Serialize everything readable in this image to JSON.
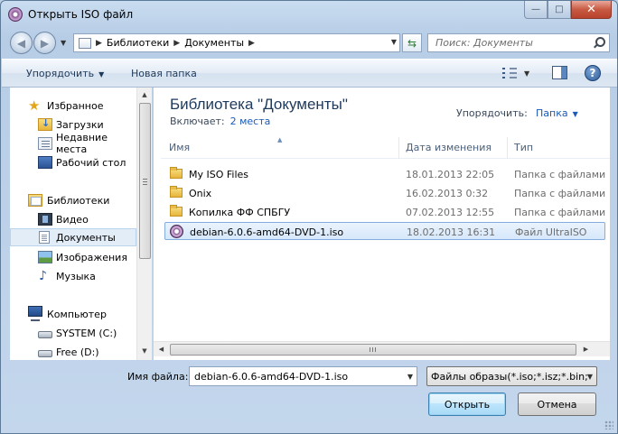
{
  "window": {
    "title": "Открыть ISO файл",
    "controls": {
      "minimize": "—",
      "maximize": "□",
      "close": "✕"
    }
  },
  "address": {
    "crumbs": [
      "Библиотеки",
      "Документы"
    ],
    "search_placeholder": "Поиск: Документы"
  },
  "toolbar": {
    "organize": "Упорядочить",
    "new_folder": "Новая папка",
    "help": "?"
  },
  "nav": {
    "favorites": {
      "label": "Избранное",
      "icon": "star-icon"
    },
    "downloads": {
      "label": "Загрузки",
      "icon": "downloads-folder-icon"
    },
    "recent": {
      "label": "Недавние места",
      "icon": "recent-places-icon"
    },
    "desktop": {
      "label": "Рабочий стол",
      "icon": "desktop-icon"
    },
    "libraries": {
      "label": "Библиотеки",
      "icon": "libraries-icon"
    },
    "video": {
      "label": "Видео",
      "icon": "video-icon"
    },
    "documents": {
      "label": "Документы",
      "icon": "documents-icon"
    },
    "images": {
      "label": "Изображения",
      "icon": "images-icon"
    },
    "music": {
      "label": "Музыка",
      "icon": "music-icon"
    },
    "computer": {
      "label": "Компьютер",
      "icon": "computer-icon"
    },
    "drive_c": {
      "label": "SYSTEM (C:)",
      "icon": "drive-icon"
    },
    "drive_d": {
      "label": "Free (D:)",
      "icon": "drive-icon"
    }
  },
  "library": {
    "title": "Библиотека \"Документы\"",
    "includes_label": "Включает:",
    "includes_link": "2 места",
    "arrange_label": "Упорядочить:",
    "arrange_value": "Папка"
  },
  "columns": {
    "name": "Имя",
    "date": "Дата изменения",
    "type": "Тип"
  },
  "files": [
    {
      "name": "My ISO Files",
      "date": "18.01.2013 22:05",
      "type": "Папка с файлами",
      "icon": "folder-icon"
    },
    {
      "name": "Onix",
      "date": "16.02.2013 0:32",
      "type": "Папка с файлами",
      "icon": "folder-icon"
    },
    {
      "name": "Копилка ФФ СПБГУ",
      "date": "07.02.2013 12:55",
      "type": "Папка с файлами",
      "icon": "folder-icon"
    },
    {
      "name": "debian-6.0.6-amd64-DVD-1.iso",
      "date": "18.02.2013 16:31",
      "type": "Файл UltraISO",
      "icon": "iso-file-icon",
      "selected": true
    }
  ],
  "bottom": {
    "filename_label": "Имя файла:",
    "filename_value": "debian-6.0.6-amd64-DVD-1.iso",
    "filter_value": "Файлы образы(*.iso;*.isz;*.bin;",
    "open": "Открыть",
    "cancel": "Отмена"
  }
}
